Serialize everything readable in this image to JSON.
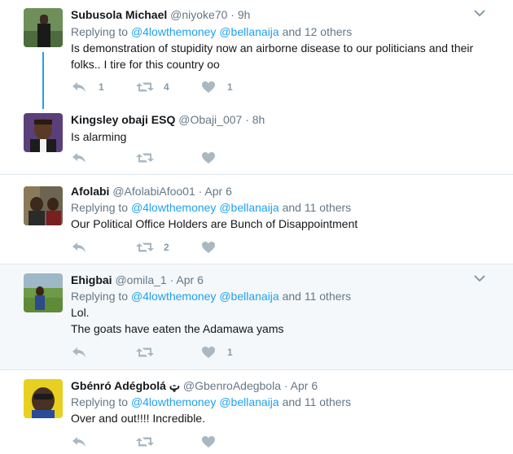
{
  "tweets": [
    {
      "fullname": "Subusola Michael",
      "handle": "@niyoke70",
      "dot": "·",
      "time": "9h",
      "reply_prefix": "Replying to",
      "mention1": "@4lowthemoney",
      "mention2": "@bellanaija",
      "others": "and 12 others",
      "text1": "Is demonstration of stupidity now an airborne disease to our politicians and their",
      "text2": "folks.. I tire for this country oo",
      "reply_count": "1",
      "retweet_count": "4",
      "like_count": "1"
    },
    {
      "fullname": "Kingsley obaji ESQ",
      "handle": "@Obaji_007",
      "dot": "·",
      "time": "8h",
      "text1": "Is alarming",
      "reply_count": "",
      "retweet_count": "",
      "like_count": ""
    },
    {
      "fullname": "Afolabi",
      "handle": "@AfolabiAfoo01",
      "dot": "·",
      "time": "Apr 6",
      "reply_prefix": "Replying to",
      "mention1": "@4lowthemoney",
      "mention2": "@bellanaija",
      "others": "and 11 others",
      "text1": "Our Political Office Holders are Bunch of Disappointment",
      "reply_count": "",
      "retweet_count": "2",
      "like_count": ""
    },
    {
      "fullname": "Ehigbai",
      "handle": "@omila_1",
      "dot": "·",
      "time": "Apr 6",
      "reply_prefix": "Replying to",
      "mention1": "@4lowthemoney",
      "mention2": "@bellanaija",
      "others": "and 11 others",
      "text1": "Lol.",
      "text2": "The goats have eaten the Adamawa yams",
      "reply_count": "",
      "retweet_count": "",
      "like_count": "1"
    },
    {
      "fullname": "Gbénró Adégbolá ټ",
      "handle": "@GbenroAdegbola",
      "dot": "·",
      "time": "Apr 6",
      "reply_prefix": "Replying to",
      "mention1": "@4lowthemoney",
      "mention2": "@bellanaija",
      "others": "and 11 others",
      "text1": "Over and out!!!! Incredible.",
      "reply_count": "",
      "retweet_count": "",
      "like_count": ""
    }
  ],
  "icons": {
    "reply": "reply-icon",
    "retweet": "retweet-icon",
    "like": "heart-icon",
    "menu": "chevron-down-icon"
  },
  "colors": {
    "link": "#1da1f2",
    "muted": "#657786",
    "action": "#aab8c2",
    "hover_bg": "#f5f8fa",
    "border": "#e1e8ed"
  }
}
